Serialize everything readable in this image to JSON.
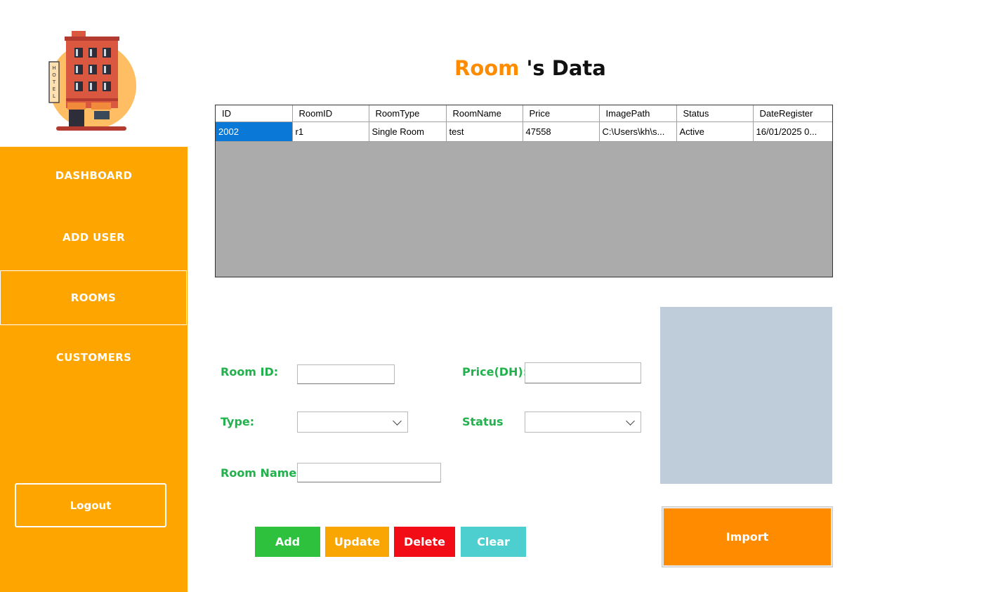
{
  "sidebar": {
    "logo_text": "HOTEL",
    "items": [
      {
        "label": "DASHBOARD"
      },
      {
        "label": "ADD USER"
      },
      {
        "label": "ROOMS"
      },
      {
        "label": "CUSTOMERS"
      }
    ],
    "active": "ROOMS",
    "logout_label": "Logout"
  },
  "title": {
    "part1": "Room",
    "part2": "'s Data"
  },
  "grid": {
    "columns": [
      "ID",
      "RoomID",
      "RoomType",
      "RoomName",
      "Price",
      "ImagePath",
      "Status",
      "DateRegister"
    ],
    "rows": [
      [
        "2002",
        "r1",
        "Single Room",
        "test",
        "47558",
        "C:\\Users\\kh\\s...",
        "Active",
        "16/01/2025 0..."
      ]
    ]
  },
  "form": {
    "room_id_label": "Room ID:",
    "room_id_value": "",
    "price_label": "Price(DH):",
    "price_value": "",
    "type_label": "Type:",
    "type_value": "",
    "status_label": "Status",
    "status_value": "",
    "room_name_label": "Room Name:",
    "room_name_value": ""
  },
  "buttons": {
    "add": "Add",
    "update": "Update",
    "delete": "Delete",
    "clear": "Clear",
    "import": "Import"
  },
  "colors": {
    "sidebar": "#fea500",
    "accent_title": "#ff8c00",
    "label_green": "#22b14c",
    "add": "#2ec13d",
    "update": "#f9a602",
    "delete": "#f10c16",
    "clear": "#4dcfd0",
    "import": "#ff8c00",
    "selection": "#0a78d7"
  }
}
